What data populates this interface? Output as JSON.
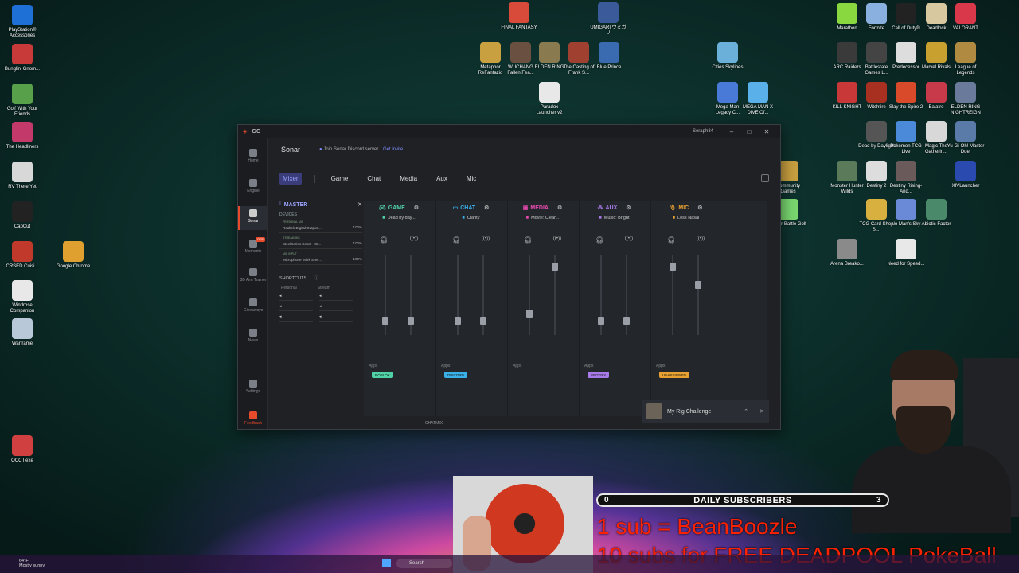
{
  "desktop": {
    "left_icons": [
      {
        "label": "PlayStation® Accessories",
        "color": "#1e6fd6"
      },
      {
        "label": "Bunglin' Gnom...",
        "color": "#c83a3a"
      },
      {
        "label": "Golf With Your Friends",
        "color": "#58a04a"
      },
      {
        "label": "The Headliners",
        "color": "#c33a6a"
      },
      {
        "label": "RV There Yet",
        "color": "#d8d8d8"
      },
      {
        "label": "CapCut",
        "color": "#222222"
      },
      {
        "label": "CRSED Cuisi...",
        "color": "#c0392b"
      },
      {
        "label": "Google Chrome",
        "color": "#e0a030"
      },
      {
        "label": "Windrose Companion",
        "color": "#e8e8e8"
      },
      {
        "label": "Warframe",
        "color": "#b8c8d8"
      },
      {
        "label": "OCCT.exe",
        "color": "#d04040"
      }
    ],
    "top_icons": [
      {
        "label": "FINAL FANTASY",
        "color": "#d84a3a"
      },
      {
        "label": "UMIGARI ウミガリ",
        "color": "#3a5a9a"
      },
      {
        "label": "Metaphor ReFantazio",
        "color": "#c8a040"
      },
      {
        "label": "WUCHANG Fallen Fea...",
        "color": "#6a5040"
      },
      {
        "label": "ELDEN RING",
        "color": "#8a7a50"
      },
      {
        "label": "The Casting of Frank S...",
        "color": "#a04030"
      },
      {
        "label": "Blue Prince",
        "color": "#3a6ab0"
      },
      {
        "label": "Paradox Launcher v2",
        "color": "#e8e8e8"
      },
      {
        "label": "Cities Skylines",
        "color": "#6ab0d8"
      },
      {
        "label": "Mega Man Legacy C...",
        "color": "#4a7ad8"
      },
      {
        "label": "MEGA MAN X DIVE Of...",
        "color": "#5ab0e8"
      }
    ],
    "right_icons": [
      {
        "label": "Marathon",
        "color": "#8ad840"
      },
      {
        "label": "Fortnite",
        "color": "#8ab0e0"
      },
      {
        "label": "Call of Duty®",
        "color": "#222222"
      },
      {
        "label": "Deadlock",
        "color": "#d8c8a0"
      },
      {
        "label": "VALORANT",
        "color": "#d8384a"
      },
      {
        "label": "ARC Raiders",
        "color": "#3a3a3a"
      },
      {
        "label": "Battlestate Games L...",
        "color": "#444444"
      },
      {
        "label": "Predecessor",
        "color": "#dddddd"
      },
      {
        "label": "Marvel Rivals",
        "color": "#c8a030"
      },
      {
        "label": "League of Legends",
        "color": "#b08a40"
      },
      {
        "label": "KILL KNIGHT",
        "color": "#c83838"
      },
      {
        "label": "Witchfire",
        "color": "#a83020"
      },
      {
        "label": "Slay the Spire 2",
        "color": "#d84a2a"
      },
      {
        "label": "Balatro",
        "color": "#c83a4a"
      },
      {
        "label": "ELDEN RING NIGHTREIGN",
        "color": "#6a7a9a"
      },
      {
        "label": "Dead by Daylight",
        "color": "#555555"
      },
      {
        "label": "Pokémon TCG Live",
        "color": "#4a8ad8"
      },
      {
        "label": "Magic The Gatherin...",
        "color": "#d8d8d8"
      },
      {
        "label": "Yu-Gi-Oh! Master Duel",
        "color": "#5a7aa8"
      },
      {
        "label": "Community Games",
        "color": "#c8a040"
      },
      {
        "label": "Monster Hunter Wilds",
        "color": "#5a7a5a"
      },
      {
        "label": "Destiny 2",
        "color": "#dddddd"
      },
      {
        "label": "Destiny Rising-And...",
        "color": "#6a5a5a"
      },
      {
        "label": "XIVLauncher",
        "color": "#2a4ab0"
      },
      {
        "label": "Super Battle Golf",
        "color": "#7ad870"
      },
      {
        "label": "TCG Card Shop Si...",
        "color": "#d8b040"
      },
      {
        "label": "No Man's Sky",
        "color": "#6a8ad8"
      },
      {
        "label": "Abiotic Factor",
        "color": "#4a8a6a"
      },
      {
        "label": "Arena Breako...",
        "color": "#8a8a8a"
      },
      {
        "label": "Need for Speed...",
        "color": "#e8e8e8"
      }
    ]
  },
  "window": {
    "app_logo": "GG",
    "username": "Seraph34",
    "controls": [
      "–",
      "□",
      "✕"
    ]
  },
  "sidenav": [
    {
      "label": "Home",
      "icon": "home-icon"
    },
    {
      "label": "Engine",
      "icon": "engine-icon"
    },
    {
      "label": "Sonar",
      "icon": "sonar-icon",
      "active": true
    },
    {
      "label": "Moments",
      "icon": "moments-icon",
      "badge": "OFF"
    },
    {
      "label": "3D Aim Trainer",
      "icon": "aim-icon"
    },
    {
      "label": "Giveaways",
      "icon": "gift-icon"
    },
    {
      "label": "News",
      "icon": "news-icon"
    },
    {
      "label": "Settings",
      "icon": "gear-icon"
    },
    {
      "label": "Feedback",
      "icon": "feedback-icon"
    }
  ],
  "header": {
    "title": "Sonar",
    "discord_text": "Join Sonar Discord server",
    "discord_link": "Get invite"
  },
  "tabs": [
    "Mixer",
    "Game",
    "Chat",
    "Media",
    "Aux",
    "Mic"
  ],
  "master": {
    "title": "MASTER",
    "devices_label": "DEVICES",
    "devices": [
      {
        "label": "PERSONAL MIX",
        "name": "Realtek Digital Output ...",
        "pct": "100%"
      },
      {
        "label": "STREAM MIX",
        "name": "SteelSeries Sonar - St...",
        "pct": "100%"
      },
      {
        "label": "MIC INPUT",
        "name": "Microphone (Mirk Sher...",
        "pct": "100%"
      }
    ],
    "shortcuts_label": "SHORTCUTS",
    "shortcut_cols": [
      "Personal",
      "Stream"
    ]
  },
  "channels": [
    {
      "name": "GAME",
      "preset": "Dead by day...",
      "color": "#4fd1a5",
      "icon": "gamepad-icon",
      "thumbs": [
        0.85,
        0.85
      ],
      "app": "ROBLOX",
      "app_color": "#4fd1a5"
    },
    {
      "name": "CHAT",
      "preset": "Clarity",
      "color": "#3ab0e8",
      "icon": "chat-icon",
      "thumbs": [
        0.85,
        0.85
      ],
      "app": "DISCORD",
      "app_color": "#3ab0e8"
    },
    {
      "name": "MEDIA",
      "preset": "Movie: Clear...",
      "color": "#e84ab0",
      "icon": "media-icon",
      "thumbs": [
        0.75,
        0.1
      ],
      "app": "",
      "app_color": "#e84ab0"
    },
    {
      "name": "AUX",
      "preset": "Music: Bright",
      "color": "#a87ae8",
      "icon": "aux-icon",
      "thumbs": [
        0.85,
        0.85
      ],
      "app": "SPOTIFY",
      "app_color": "#a87ae8"
    },
    {
      "name": "MIC",
      "preset": "Less Nasal",
      "color": "#e8a030",
      "icon": "mic-icon",
      "thumbs": [
        0.1,
        0.35
      ],
      "app": "UNASSIGNED",
      "app_color": "#e8a030"
    }
  ],
  "apps_label": "Apps",
  "chatmix_label": "CHATMIX",
  "notification": {
    "text": "My Rig Challenge"
  },
  "overlay": {
    "subs_title": "DAILY SUBSCRIBERS",
    "subs_current": "0",
    "subs_goal": "3",
    "promo1": "1 sub = BeanBoozle",
    "promo2": "10 subs for FREE DEADPOOL PokeBall"
  },
  "taskbar": {
    "temp": "64°F",
    "weather": "Mostly sunny",
    "search_placeholder": "Search"
  }
}
